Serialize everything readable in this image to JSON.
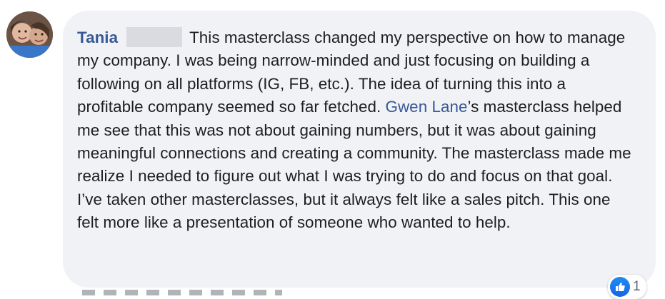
{
  "comment": {
    "author": "Tania",
    "text_part1": "This masterclass changed my perspective on how to manage my company. I was being narrow-minded and just focusing on building a following on all platforms (IG, FB, etc.). The idea of turning this into a profitable company seemed so far fetched. ",
    "mention": "Gwen Lane",
    "text_part2": "’s masterclass helped me see that this was not about gaining numbers, but it was about gaining meaningful connections and creating a community. The masterclass made me realize I needed to figure out what I was trying to do and focus on that goal. I’ve taken other masterclasses, but it always felt like a sales pitch. This one felt more like a presentation of someone who wanted to help."
  },
  "reactions": {
    "icon": "like-icon",
    "count": "1"
  },
  "colors": {
    "bubble": "#f0f2f5",
    "link": "#385898",
    "text": "#1c1e21",
    "like": "#1877f2"
  }
}
